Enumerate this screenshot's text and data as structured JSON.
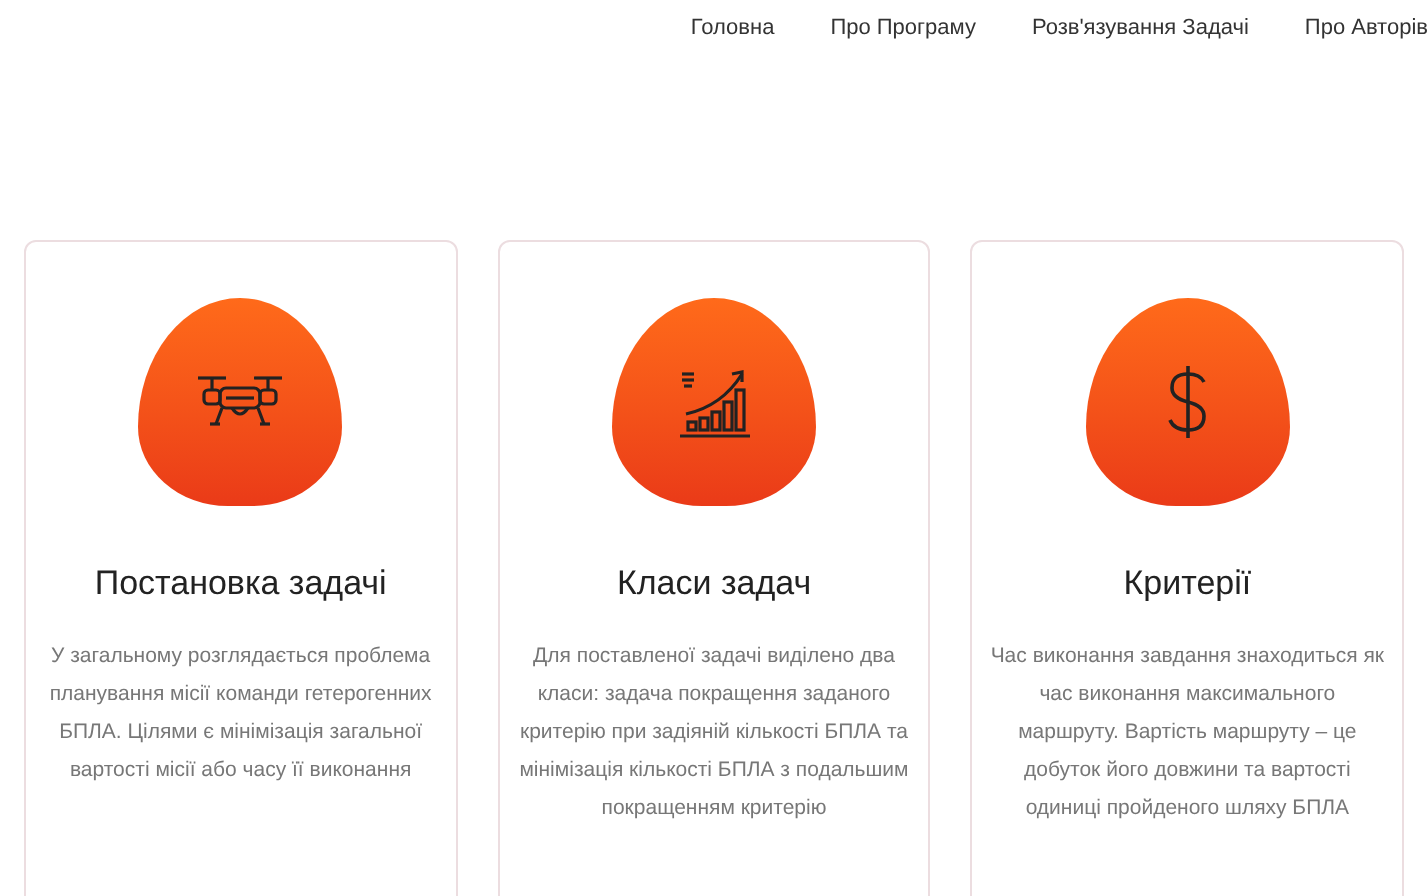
{
  "nav": [
    {
      "label": "Головна"
    },
    {
      "label": "Про Програму"
    },
    {
      "label": "Розв'язування Задачі"
    },
    {
      "label": "Про Авторів"
    }
  ],
  "cards": [
    {
      "kind": "drone",
      "title": "Постановка задачі",
      "text": "У загальному розглядається проблема планування місії команди гетерогенних БПЛА. Цілями є мінімізація загальної вартості місії або часу її виконання"
    },
    {
      "kind": "chart",
      "title": "Класи задач",
      "text": "Для поставленої задачі виділено два класи: задача покращення заданого критерію при задіяній кількості БПЛА та мінімізація кількості БПЛА з подальшим покращенням критерію"
    },
    {
      "kind": "dollar",
      "title": "Критерії",
      "text": "Час виконання завдання знаходиться як час виконання максимального маршруту. Вартість маршруту – це добуток його довжини та вартості одиниці пройденого шляху БПЛА"
    }
  ]
}
